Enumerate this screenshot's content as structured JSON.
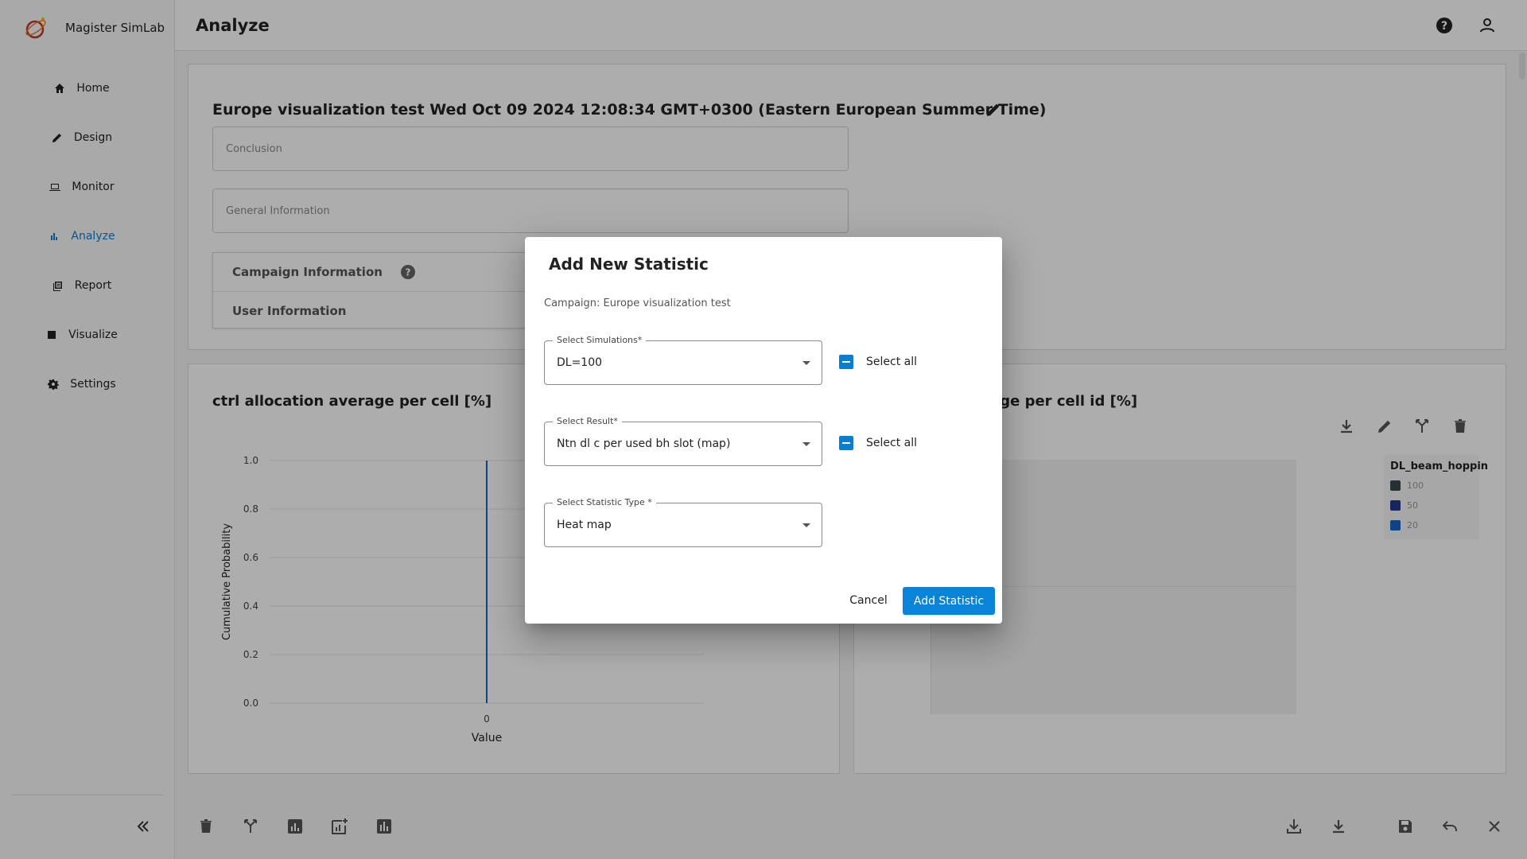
{
  "app": {
    "name": "Magister SimLab"
  },
  "sidebar": {
    "items": [
      {
        "label": "Home",
        "icon": "home-icon"
      },
      {
        "label": "Design",
        "icon": "pencil-icon"
      },
      {
        "label": "Monitor",
        "icon": "laptop-icon"
      },
      {
        "label": "Analyze",
        "icon": "bar-chart-icon",
        "active": true
      },
      {
        "label": "Report",
        "icon": "report-icon"
      },
      {
        "label": "Visualize",
        "icon": "image-icon"
      },
      {
        "label": "Settings",
        "icon": "gear-icon"
      }
    ],
    "collapse_label": "«"
  },
  "header": {
    "title": "Analyze"
  },
  "campaign": {
    "title": "Europe visualization test Wed Oct 09 2024 12:08:34 GMT+0300 (Eastern European Summer Time)",
    "conclusion_placeholder": "Conclusion",
    "general_info_placeholder": "General Information",
    "campaign_info_label": "Campaign Information",
    "user_info_label": "User Information"
  },
  "charts": {
    "left": {
      "title": "ctrl allocation average per cell [%]"
    },
    "right": {
      "title_visible": "erage per cell id [%]",
      "legend_title": "DL_beam_hoppin",
      "legend_items": [
        {
          "label": "100",
          "color": "#37474f"
        },
        {
          "label": "50",
          "color": "#283593"
        },
        {
          "label": "20",
          "color": "#1565c0"
        }
      ]
    }
  },
  "chart_data": {
    "type": "line",
    "title": "ctrl allocation average per cell [%]",
    "xlabel": "Value",
    "ylabel": "Cumulative Probability",
    "x_ticks": [
      "0"
    ],
    "y_ticks": [
      "0.0",
      "0.2",
      "0.4",
      "0.6",
      "0.8",
      "1.0"
    ],
    "ylim": [
      0,
      1
    ],
    "series": [
      {
        "x": [
          0,
          0
        ],
        "y": [
          0,
          1
        ],
        "color": "#1565c0"
      }
    ],
    "grid": true
  },
  "dialog": {
    "title": "Add New Statistic",
    "campaign_text": "Campaign: Europe visualization test",
    "simulations": {
      "label": "Select Simulations*",
      "value": "DL=100"
    },
    "result": {
      "label": "Select Result*",
      "value": "Ntn dl c per used bh slot (map)"
    },
    "statistic_type": {
      "label": "Select Statistic Type *",
      "value": "Heat map"
    },
    "select_all_label": "Select all",
    "cancel_label": "Cancel",
    "add_label": "Add Statistic",
    "accent": "#0a84d8"
  }
}
